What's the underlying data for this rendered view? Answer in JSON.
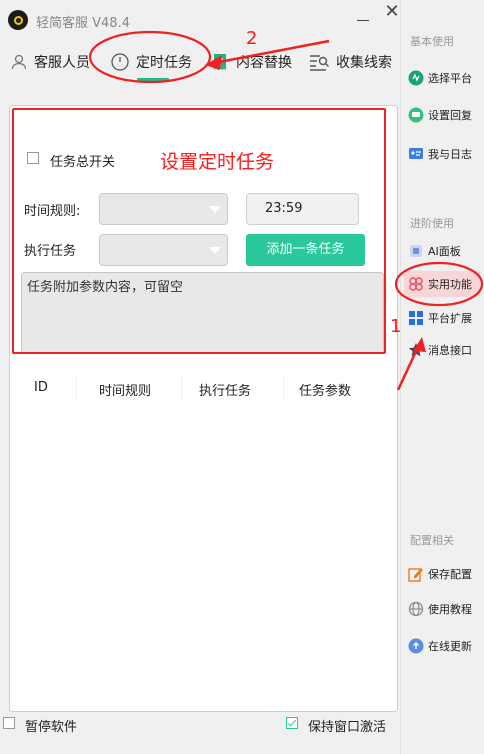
{
  "app": {
    "title": "轻简客服  V48.4"
  },
  "tabs": [
    {
      "label": "客服人员",
      "icon": "person-icon"
    },
    {
      "label": "定时任务",
      "icon": "clock-icon",
      "active": true
    },
    {
      "label": "内容替换",
      "icon": "receipt-icon"
    },
    {
      "label": "收集线索",
      "icon": "list-search-icon"
    }
  ],
  "form": {
    "master_switch_label": "任务总开关",
    "master_switch_checked": false,
    "time_rule_label": "时间规则:",
    "time_rule_value": "",
    "time_value": "23:59",
    "exec_task_label": "执行任务",
    "exec_task_value": "",
    "add_button_label": "添加一条任务",
    "params_placeholder": "任务附加参数内容，可留空"
  },
  "table": {
    "columns": [
      "ID",
      "时间规则",
      "执行任务",
      "任务参数"
    ],
    "rows": []
  },
  "sidebar": {
    "sections": [
      {
        "title": "基本使用",
        "items": [
          {
            "label": "选择平台",
            "icon": "platform-icon"
          },
          {
            "label": "设置回复",
            "icon": "reply-icon"
          },
          {
            "label": "我与日志",
            "icon": "log-icon"
          }
        ]
      },
      {
        "title": "进阶使用",
        "items": [
          {
            "label": "AI面板",
            "icon": "ai-panel-icon"
          },
          {
            "label": "实用功能",
            "icon": "tools-icon",
            "active": true
          },
          {
            "label": "平台扩展",
            "icon": "extension-icon"
          },
          {
            "label": "消息接口",
            "icon": "star-icon"
          }
        ]
      },
      {
        "title": "配置相关",
        "items": [
          {
            "label": "保存配置",
            "icon": "edit-icon"
          },
          {
            "label": "使用教程",
            "icon": "globe-icon"
          },
          {
            "label": "在线更新",
            "icon": "cloud-upload-icon"
          }
        ]
      }
    ]
  },
  "footer": {
    "pause_label": "暂停软件",
    "pause_checked": false,
    "keep_active_label": "保持窗口激活",
    "keep_active_checked": true
  },
  "annotations": {
    "box_label": "设置定时任务",
    "step1": "1",
    "step2": "2",
    "color": "#ff1a1a"
  },
  "colors": {
    "accent": "#29c99c",
    "active_sidebar_bg": "#f8d6d8",
    "annotation_red": "#ff1a1a"
  }
}
